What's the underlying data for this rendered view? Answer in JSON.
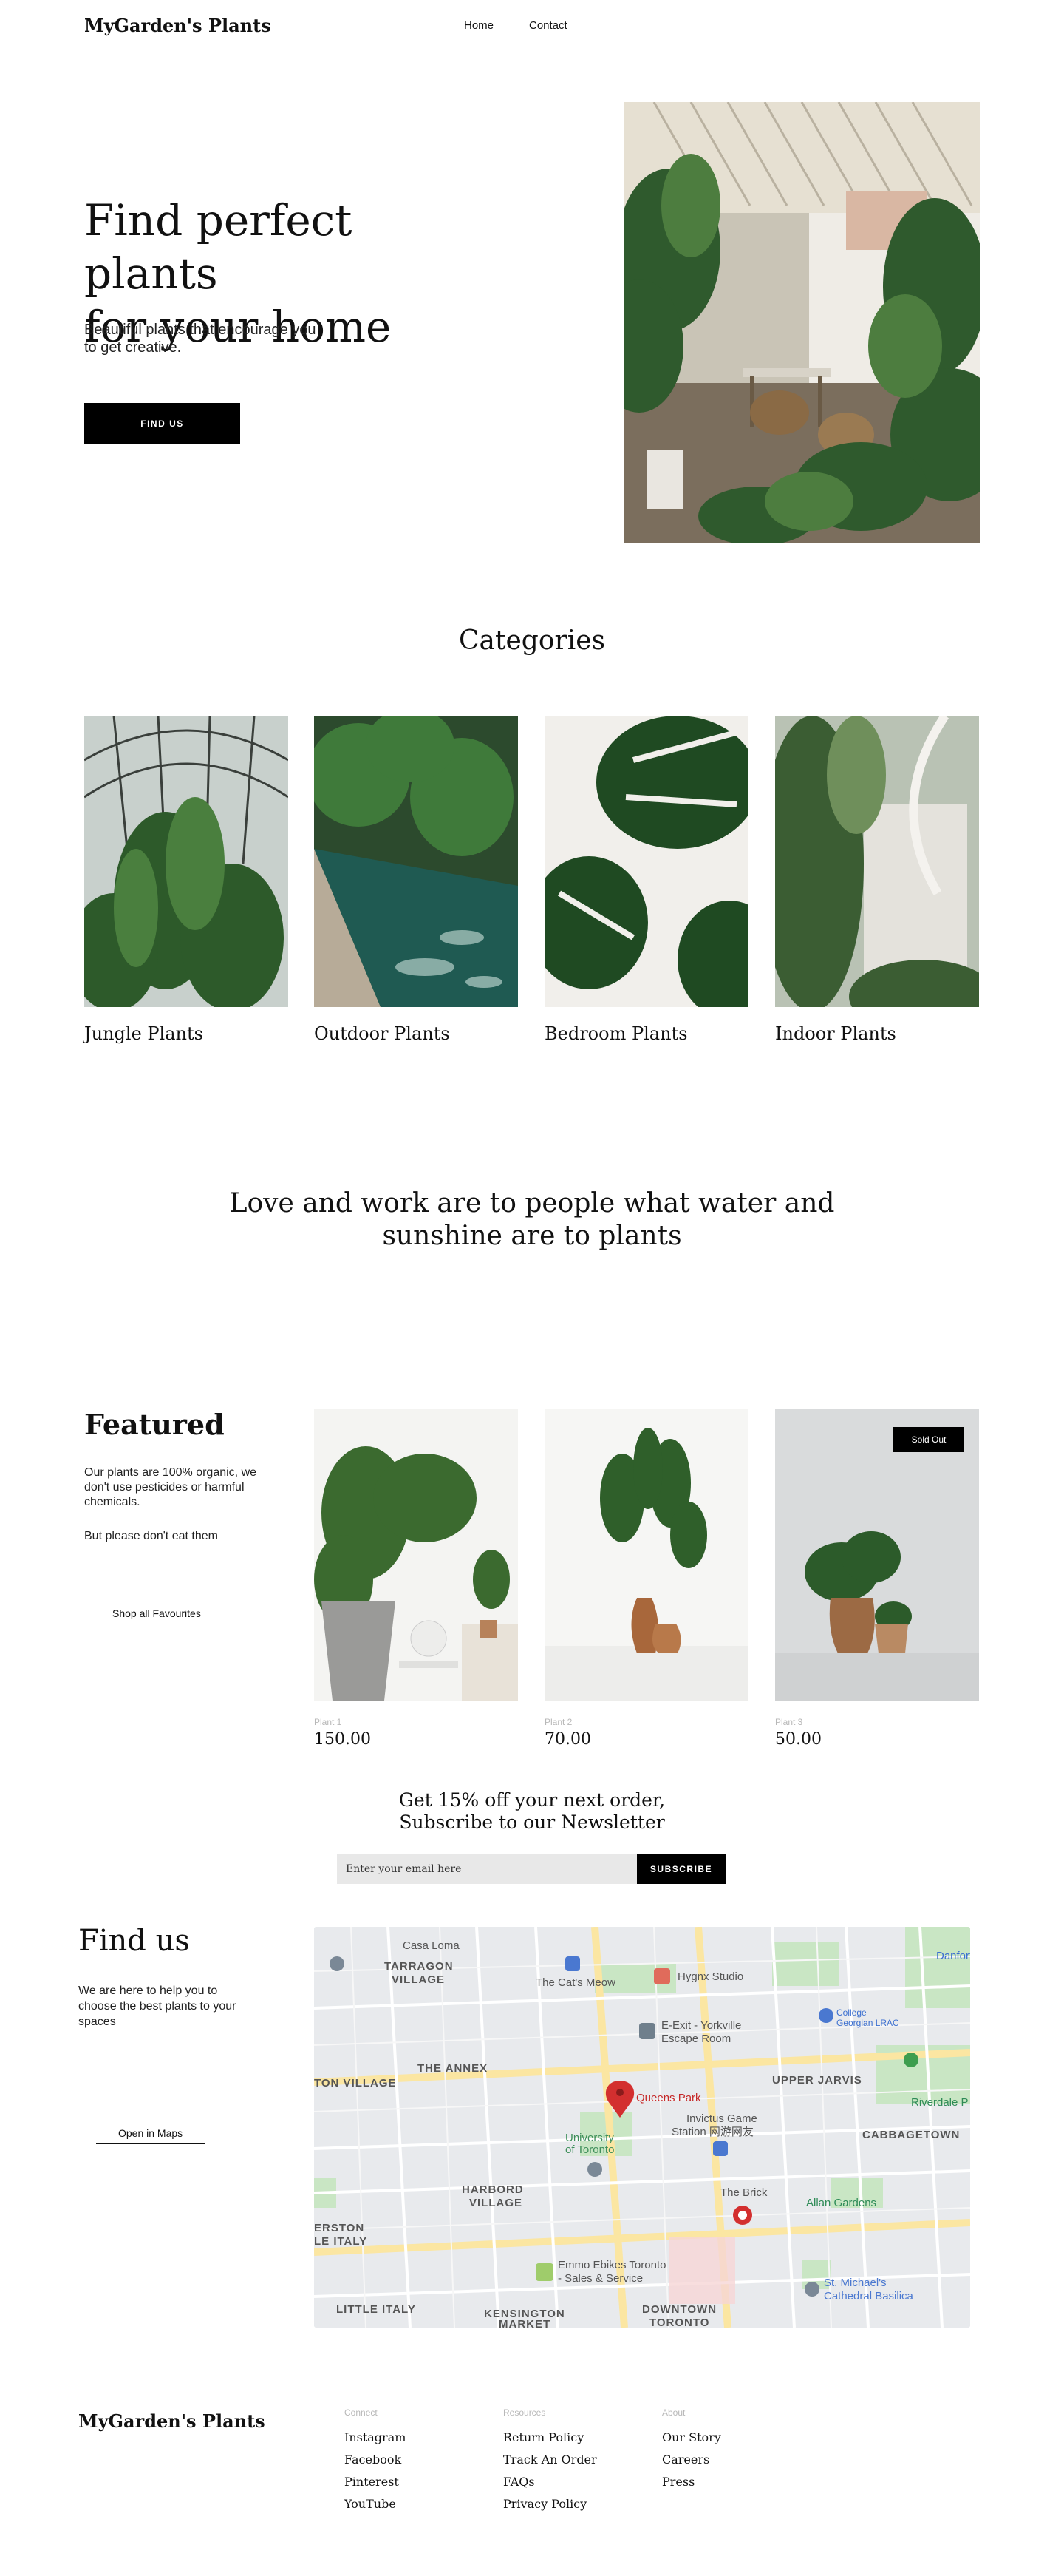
{
  "header": {
    "logo": "MyGarden's Plants",
    "nav": [
      {
        "label": "Home"
      },
      {
        "label": "Contact"
      }
    ]
  },
  "hero": {
    "title_line1": "Find perfect plants",
    "title_line2": "for your home",
    "subtitle": "Beautiful plants that encourage you to get creative.",
    "cta_label": "FIND US"
  },
  "categories": {
    "title": "Categories",
    "items": [
      {
        "label": "Jungle Plants"
      },
      {
        "label": "Outdoor Plants"
      },
      {
        "label": "Bedroom Plants"
      },
      {
        "label": "Indoor Plants"
      }
    ]
  },
  "quote": {
    "text": "Love and work are to people what water and sunshine are to plants"
  },
  "featured": {
    "title": "Featured",
    "paragraph1": "Our plants are 100% organic, we don't use pesticides or harmful chemicals.",
    "paragraph2": "But please don't eat them",
    "link_label": "Shop all Favourites",
    "products": [
      {
        "name": "Plant 1",
        "price": "150.00"
      },
      {
        "name": "Plant 2",
        "price": "70.00"
      },
      {
        "name": "Plant 3",
        "price": "50.00",
        "badge": "Sold Out"
      }
    ]
  },
  "newsletter": {
    "title_line1": "Get 15% off your next order,",
    "title_line2": "Subscribe to our Newsletter",
    "input_placeholder": "Enter your email here",
    "button_label": "SUBSCRIBE"
  },
  "find_us": {
    "title": "Find us",
    "text": "We are here to help you to choose the best plants to your spaces",
    "button_label": "Open in Maps",
    "map": {
      "labels": [
        {
          "text": "Casa Loma"
        },
        {
          "text": "TARRAGON"
        },
        {
          "text": "VILLAGE"
        },
        {
          "text": "The Cat's Meow"
        },
        {
          "text": "Hygnx Studio"
        },
        {
          "text": "Danforth"
        },
        {
          "text": "THE ANNEX"
        },
        {
          "text": "E-Exit - Yorkville"
        },
        {
          "text": "Escape Room"
        },
        {
          "text": "College"
        },
        {
          "text": "Georgian LRAC"
        },
        {
          "text": "TON VILLAGE"
        },
        {
          "text": "Queens Park"
        },
        {
          "text": "UPPER JARVIS"
        },
        {
          "text": "Riverdale P"
        },
        {
          "text": "University"
        },
        {
          "text": "of Toronto"
        },
        {
          "text": "Invictus Game"
        },
        {
          "text": "Station 网游网友"
        },
        {
          "text": "CABBAGETOWN"
        },
        {
          "text": "HARBORD"
        },
        {
          "text": "VILLAGE"
        },
        {
          "text": "The Brick"
        },
        {
          "text": "Allan Gardens"
        },
        {
          "text": "ERSTON"
        },
        {
          "text": "LE ITALY"
        },
        {
          "text": "Emmo Ebikes Toronto"
        },
        {
          "text": "- Sales & Service"
        },
        {
          "text": "St. Michael's"
        },
        {
          "text": "Cathedral Basilica"
        },
        {
          "text": "LITTLE ITALY"
        },
        {
          "text": "KENSINGTON"
        },
        {
          "text": "MARKET"
        },
        {
          "text": "DOWNTOWN"
        },
        {
          "text": "TORONTO"
        }
      ]
    }
  },
  "footer": {
    "logo": "MyGarden's Plants",
    "columns": [
      {
        "heading": "Connect",
        "links": [
          "Instagram",
          "Facebook",
          "Pinterest",
          "YouTube"
        ]
      },
      {
        "heading": "Resources",
        "links": [
          "Return Policy",
          "Track An Order",
          "FAQs",
          "Privacy Policy"
        ]
      },
      {
        "heading": "About",
        "links": [
          "Our Story",
          "Careers",
          "Press"
        ]
      }
    ]
  },
  "colors": {
    "accent": "#000000",
    "text": "#111111",
    "muted": "#b8b8b8",
    "input_bg": "#e8e8e8",
    "map_pin": "#d32f2f"
  }
}
